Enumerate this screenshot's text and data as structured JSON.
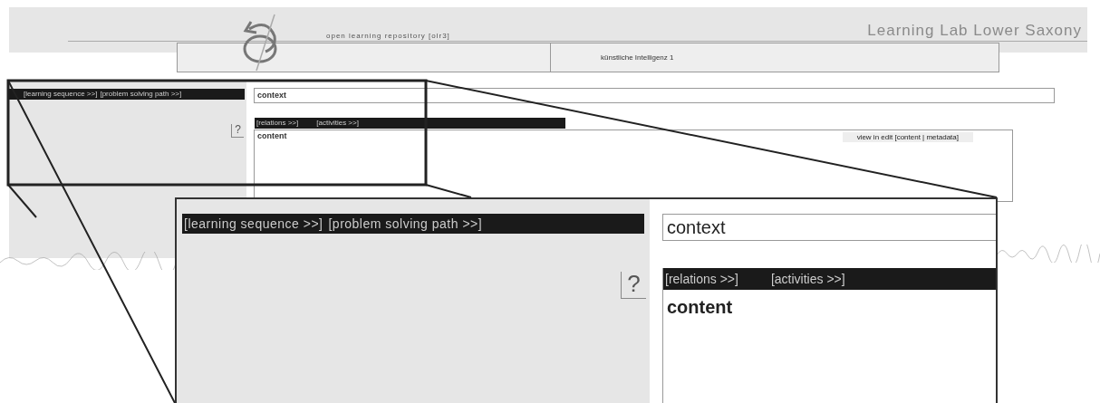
{
  "header": {
    "repository": "open learning repository [olr3]",
    "organization": "Learning Lab Lower Saxony"
  },
  "course_title": "künstliche Intelligenz 1",
  "page": {
    "navigation": [
      "[learning sequence >>]",
      "[problem solving path >>]"
    ],
    "context": "context",
    "help": "?",
    "content_menu": [
      "[relations >>]",
      "[activities >>]"
    ],
    "content": "content",
    "view_links": "view in edit [content | metadata]"
  },
  "magnified": {
    "navigation": [
      "[learning sequence >>]",
      "[problem solving path >>]"
    ],
    "context": "context",
    "help": "?",
    "content_menu": [
      "[relations >>]",
      "[activities >>]"
    ],
    "content": "content"
  }
}
